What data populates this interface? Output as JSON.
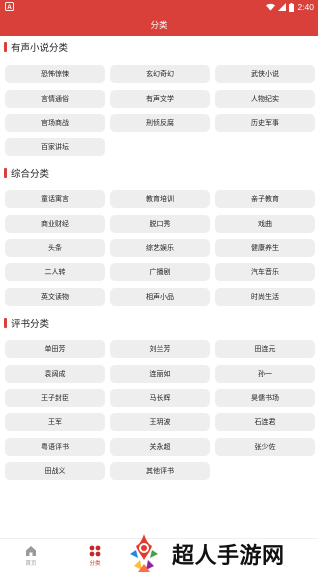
{
  "status_bar": {
    "time": "2:40",
    "left_icon": "app-notification-icon",
    "icons": [
      "wifi-icon",
      "signal-icon",
      "battery-icon"
    ]
  },
  "header": {
    "title": "分类"
  },
  "sections": [
    {
      "title": "有声小说分类",
      "items": [
        "恐怖惊悚",
        "玄幻奇幻",
        "武侠小说",
        "言情通俗",
        "有声文学",
        "人物纪实",
        "官场商战",
        "刑侦反腐",
        "历史军事",
        "百家讲坛"
      ]
    },
    {
      "title": "综合分类",
      "items": [
        "童话寓言",
        "教育培训",
        "亲子教育",
        "商业财经",
        "脱口秀",
        "戏曲",
        "头条",
        "综艺娱乐",
        "健康养生",
        "二人转",
        "广播剧",
        "汽车音乐",
        "英文读物",
        "相声小品",
        "时尚生活"
      ]
    },
    {
      "title": "评书分类",
      "items": [
        "单田芳",
        "刘兰芳",
        "田连元",
        "袁阔成",
        "连丽如",
        "孙一",
        "王子封臣",
        "马长辉",
        "昊儒书场",
        "王军",
        "王玥波",
        "石连君",
        "粤语评书",
        "关永超",
        "张少佐",
        "田战义",
        "其他评书"
      ]
    }
  ],
  "bottom_nav": {
    "items": [
      {
        "label": "首页",
        "icon": "home-icon",
        "active": false
      },
      {
        "label": "分类",
        "icon": "category-icon",
        "active": true
      }
    ]
  },
  "watermark": {
    "text": "超人手游网",
    "icon": "superman-logo-icon"
  },
  "colors": {
    "accent": "#d9403a",
    "chip_bg": "#eeeeee",
    "text": "#222222"
  }
}
